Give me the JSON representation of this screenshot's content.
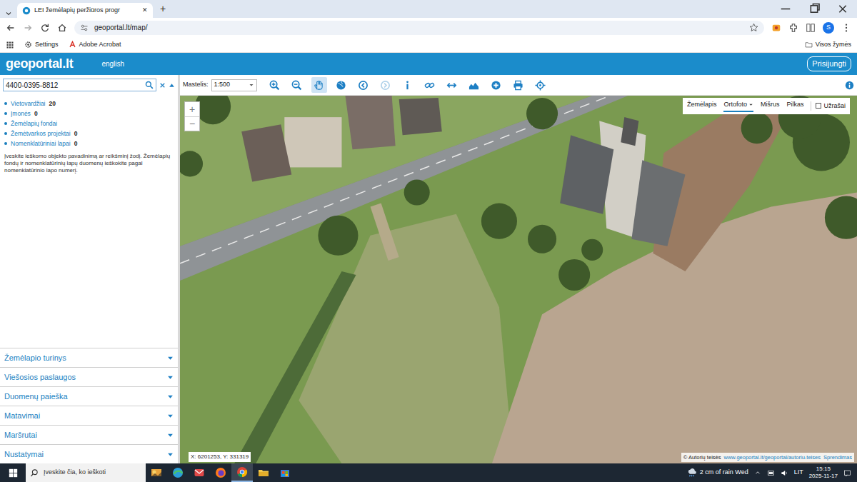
{
  "browser": {
    "tab": {
      "title": "LEI žemėlapių peržiūros progr",
      "selected": true,
      "close": "✕"
    },
    "new_tab": "+",
    "address": "geoportal.lt/map/",
    "profile": "S",
    "bookmarks": [
      "Settings",
      "Adobe Acrobat"
    ],
    "all_bookmarks": "Visos žymės"
  },
  "app": {
    "logo": "geoportal.lt",
    "language": "english",
    "login": "Prisijungti"
  },
  "search": {
    "value": "4400-0395-8812"
  },
  "results": [
    {
      "label": "Vietovardžiai",
      "count": "20"
    },
    {
      "label": "Įmonės",
      "count": "0"
    },
    {
      "label": "Žemėlapių fondai"
    },
    {
      "label": "Žemėtvarkos projektai",
      "count": "0"
    },
    {
      "label": "Nomenklatūriniai lapai",
      "count": "0"
    }
  ],
  "hint": "Įveskite ieškomo objekto pavadinimą ar reikšminį žodį. Žemėlapių fondų ir nomenklatūrinių lapų duomenų ieškokite pagal nomenklatūrinio lapo numerį.",
  "panels": [
    {
      "label": "Žemėlapio turinys",
      "expanded": false
    },
    {
      "label": "Viešosios paslaugos",
      "expanded": false
    },
    {
      "label": "Duomenų paieška",
      "expanded": false
    },
    {
      "label": "Matavimai",
      "expanded": false
    },
    {
      "label": "Maršrutai",
      "expanded": false
    },
    {
      "label": "Nustatymai",
      "expanded": false
    }
  ],
  "toolbar": {
    "scale_label": "Mastelis:",
    "scale": "1:500",
    "tools": [
      {
        "kind": "zoomin",
        "selected": false,
        "disabled": false
      },
      {
        "kind": "zoomout",
        "selected": false,
        "disabled": false
      },
      {
        "kind": "pan",
        "selected": true,
        "disabled": false
      },
      {
        "kind": "globe",
        "selected": false,
        "disabled": false
      },
      {
        "kind": "back",
        "selected": false,
        "disabled": false
      },
      {
        "kind": "forward",
        "selected": false,
        "disabled": true
      },
      {
        "kind": "identify",
        "selected": false,
        "disabled": false
      },
      {
        "kind": "link",
        "selected": false,
        "disabled": false
      },
      {
        "kind": "measure",
        "selected": false,
        "disabled": false
      },
      {
        "kind": "profile",
        "selected": false,
        "disabled": false
      },
      {
        "kind": "add",
        "selected": false,
        "disabled": false
      },
      {
        "kind": "print",
        "selected": false,
        "disabled": false
      },
      {
        "kind": "locate",
        "selected": false,
        "disabled": false
      }
    ]
  },
  "map": {
    "zoom": [
      "+",
      "−"
    ],
    "layers": [
      {
        "label": "Žemėlapis",
        "selected": false
      },
      {
        "label": "Ortofoto",
        "selected": true
      },
      {
        "label": "Mišrus",
        "selected": false
      },
      {
        "label": "Pilkas",
        "selected": false
      }
    ],
    "labels": {
      "label": "Užrašai",
      "checked": false
    },
    "coordinates": "X: 6201253, Y: 331319",
    "copyright": "© Autorių teisės",
    "copyright_link": "www.geoportal.lt/geoportal/autoriu-teises",
    "solution": "Sprendimas"
  },
  "taskbar": {
    "search_placeholder": "Įveskite čia, ko ieškoti",
    "apps": [
      {
        "kind": "news",
        "selected": false
      },
      {
        "kind": "edge",
        "selected": false
      },
      {
        "kind": "mail",
        "selected": false
      },
      {
        "kind": "firefox",
        "selected": false
      },
      {
        "kind": "chrome",
        "selected": true
      },
      {
        "kind": "explorer",
        "selected": false
      },
      {
        "kind": "store",
        "selected": false
      }
    ],
    "weather": "2 cm of rain Wed",
    "language": "LIT",
    "time": "15:15",
    "date": "2025-11-17"
  }
}
